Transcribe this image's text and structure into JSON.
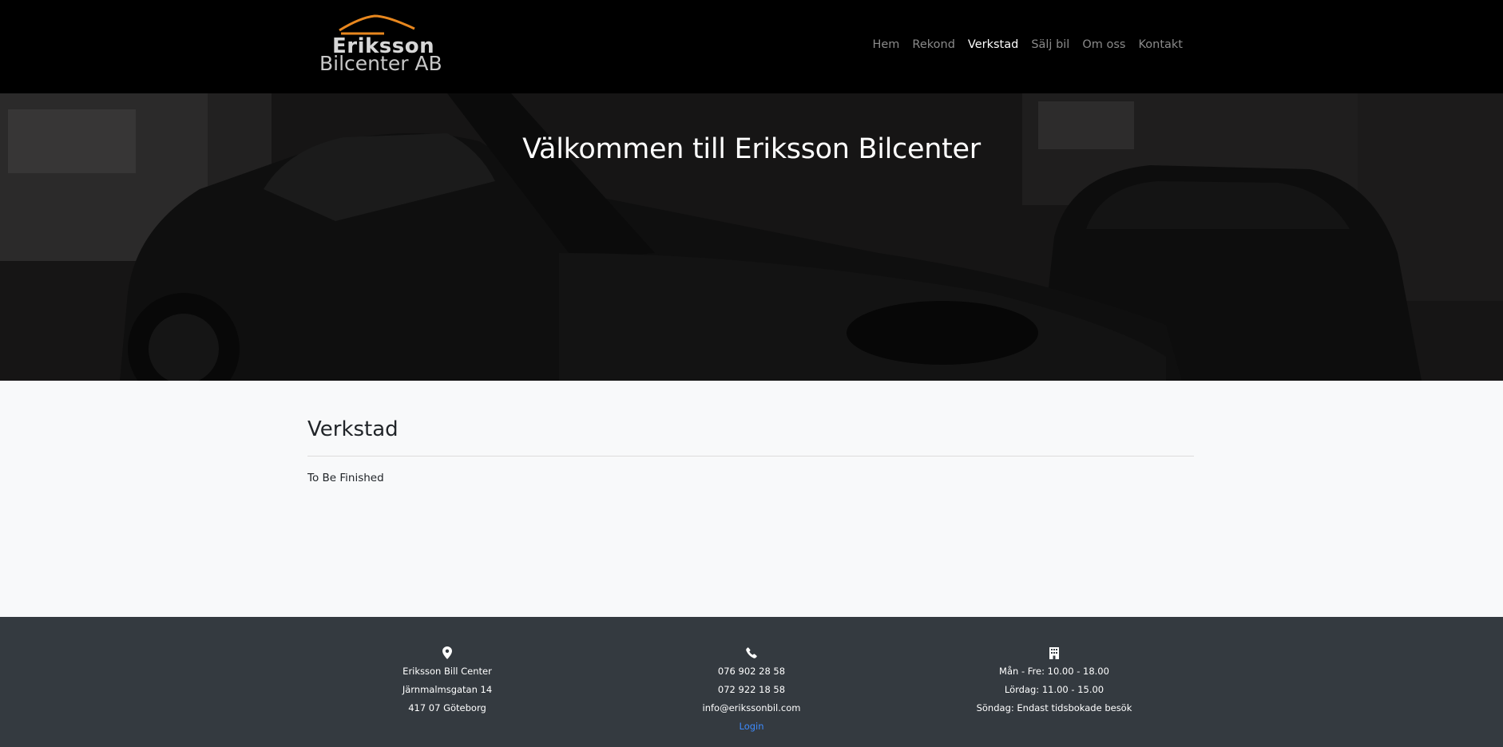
{
  "brand": {
    "line1": "Eriksson",
    "line2": "Bilcenter AB",
    "accent": "#e8871e"
  },
  "nav": [
    {
      "label": "Hem",
      "active": false
    },
    {
      "label": "Rekond",
      "active": false
    },
    {
      "label": "Verkstad",
      "active": true
    },
    {
      "label": "Sälj bil",
      "active": false
    },
    {
      "label": "Om oss",
      "active": false
    },
    {
      "label": "Kontakt",
      "active": false
    }
  ],
  "hero": {
    "title": "Välkommen till Eriksson Bilcenter"
  },
  "main": {
    "heading": "Verkstad",
    "body": "To Be Finished"
  },
  "footer": {
    "address": {
      "icon": "map-pin-icon",
      "lines": [
        "Eriksson Bill Center",
        "Järnmalmsgatan 14",
        "417 07 Göteborg"
      ]
    },
    "contact": {
      "icon": "phone-icon",
      "lines": [
        "076 902 28 58",
        "072 922 18 58",
        "info@erikssonbil.com"
      ],
      "login": "Login"
    },
    "hours": {
      "icon": "building-icon",
      "lines": [
        "Mån - Fre: 10.00 - 18.00",
        "Lördag: 11.00 - 15.00",
        "Söndag: Endast tidsbokade besök"
      ]
    }
  }
}
